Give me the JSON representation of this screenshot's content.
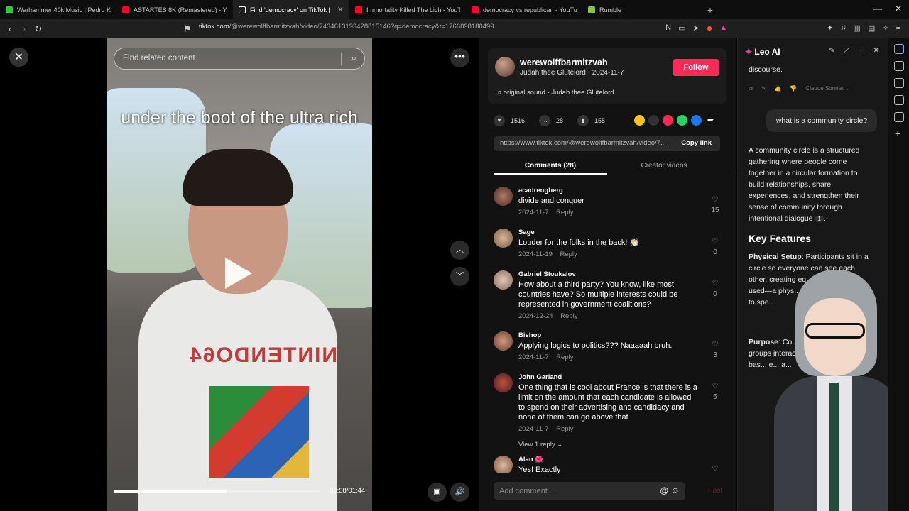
{
  "browser": {
    "tabs": [
      {
        "title": "Warhammer 40k Music | Pedro Ka",
        "color": "#2ecc40"
      },
      {
        "title": "ASTARTES 8K (Remastered) - YouT",
        "color": "#ff0033"
      },
      {
        "title": "Find 'democracy' on TikTok | ",
        "color": "#ffffff",
        "active": true
      },
      {
        "title": "Immortality Killed The Lich - YouT",
        "color": "#ff0033"
      },
      {
        "title": "democracy vs republican - YouTub",
        "color": "#ff0033"
      },
      {
        "title": "Rumble",
        "color": "#85c742"
      }
    ],
    "new_tab": "+",
    "url_domain": "tiktok.com",
    "url_path": "/@werewolffbarmitzvah/video/7434613193428815146?q=democracy&t=1766898180499"
  },
  "video": {
    "search_placeholder": "Find related content",
    "caption": "under the boot of the ultra rich",
    "shirt_text": "NINTENDO64",
    "time": "00:58/01:44",
    "progress": 0.55
  },
  "post": {
    "username": "werewolffbarmitzvah",
    "subline": "Judah thee Glutelord · 2024-11-7",
    "follow_label": "Follow",
    "sound": "original sound - Judah thee Glutelord",
    "likes": "1516",
    "comments": "28",
    "saves": "155",
    "link": "https://www.tiktok.com/@werewolffbarmitzvah/video/7...",
    "copy_label": "Copy link",
    "tab_comments": "Comments (28)",
    "tab_creator": "Creator videos",
    "add_comment_placeholder": "Add comment...",
    "post_label": "Post"
  },
  "comments": [
    {
      "name": "acadrengberg",
      "text": "divide and conquer",
      "meta": "2024-11-7",
      "reply": "Reply",
      "likes": "15"
    },
    {
      "name": "Sage",
      "text": "Louder for the folks in the back! 👏🏻",
      "meta": "2024-11-19",
      "reply": "Reply",
      "likes": "0"
    },
    {
      "name": "Gabriel Stoukalov",
      "text": "How about a third party? You know, like most countries have? So multiple interests could be represented in government coalitions?",
      "meta": "2024-12-24",
      "reply": "Reply",
      "likes": "0"
    },
    {
      "name": "Bishop",
      "text": "Applying logics to politics??? Naaaaah bruh.",
      "meta": "2024-11-7",
      "reply": "Reply",
      "likes": "3"
    },
    {
      "name": "John Garland",
      "text": "One thing that is cool about France is that there is a limit on the amount that each candidate is allowed to spend on their advertising and candidacy and none of them can go above that",
      "meta": "2024-11-7",
      "reply": "Reply",
      "likes": "6",
      "view_replies": "View 1 reply"
    },
    {
      "name": "Alan 🌺",
      "text": "Yes! Exactly",
      "meta": "",
      "reply": "",
      "likes": ""
    }
  ],
  "leo": {
    "title": "Leo AI",
    "prev_text": "discourse.",
    "model": "Claude Sonnet",
    "question": "what is a community circle?",
    "answer": "A community circle is a structured gathering where people come together in a circular formation to build relationships, share experiences, and strengthen their sense of community through intentional dialogue",
    "citation": "1",
    "heading": "Key Features",
    "f1_label": "Physical Setup",
    "f1_text": ": Participants sit in a circle so everyone can see each other, creating eq... connection. A ... used—a phys... around that ... floor to spe...",
    "f2_label": "Purpose",
    "f2_text": ": Co... establish foun... groups interact ... ries, perspectiv... bas... e... a..."
  },
  "colors": {
    "follow": "#fe2c55",
    "leo_accent": "#e0459e"
  }
}
